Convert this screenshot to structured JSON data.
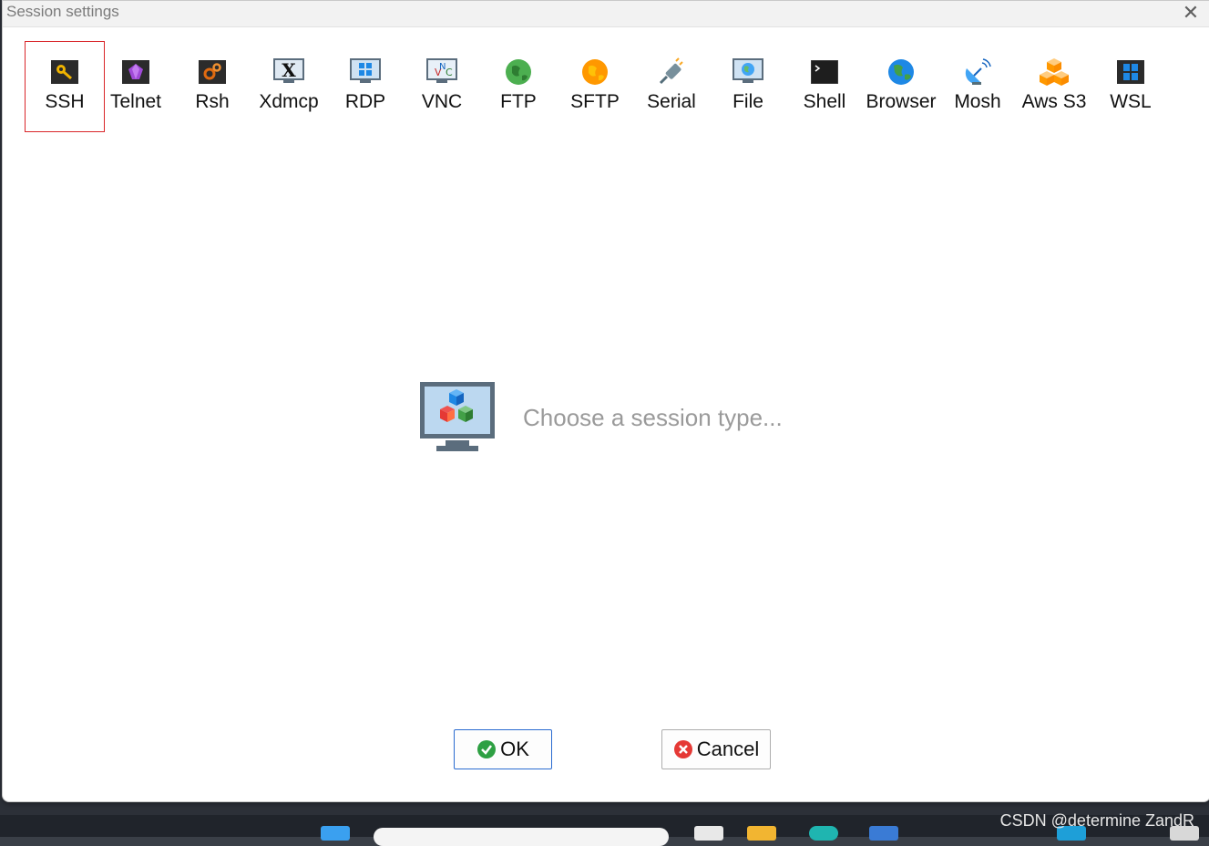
{
  "window": {
    "title": "Session settings",
    "close_glyph": "✕"
  },
  "session_types": [
    {
      "label": "SSH",
      "icon": "key-icon",
      "selected": true
    },
    {
      "label": "Telnet",
      "icon": "telnet-gem-icon"
    },
    {
      "label": "Rsh",
      "icon": "rsh-gears-icon"
    },
    {
      "label": "Xdmcp",
      "icon": "x-monitor-icon"
    },
    {
      "label": "RDP",
      "icon": "windows-monitor-icon"
    },
    {
      "label": "VNC",
      "icon": "vnc-monitor-icon"
    },
    {
      "label": "FTP",
      "icon": "globe-green-icon"
    },
    {
      "label": "SFTP",
      "icon": "globe-orange-icon"
    },
    {
      "label": "Serial",
      "icon": "serial-plug-icon"
    },
    {
      "label": "File",
      "icon": "file-monitor-icon"
    },
    {
      "label": "Shell",
      "icon": "terminal-icon"
    },
    {
      "label": "Browser",
      "icon": "globe-blue-icon"
    },
    {
      "label": "Mosh",
      "icon": "satellite-dish-icon"
    },
    {
      "label": "Aws S3",
      "icon": "cubes-icon"
    },
    {
      "label": "WSL",
      "icon": "windows-tile-icon"
    }
  ],
  "main": {
    "hint": "Choose a session type..."
  },
  "buttons": {
    "ok": "OK",
    "cancel": "Cancel"
  },
  "watermark": "CSDN @determine  ZandR",
  "colors": {
    "selection_border": "#d9262a",
    "ok_border": "#2a6bd0",
    "hint_text": "#9a9a9a"
  }
}
